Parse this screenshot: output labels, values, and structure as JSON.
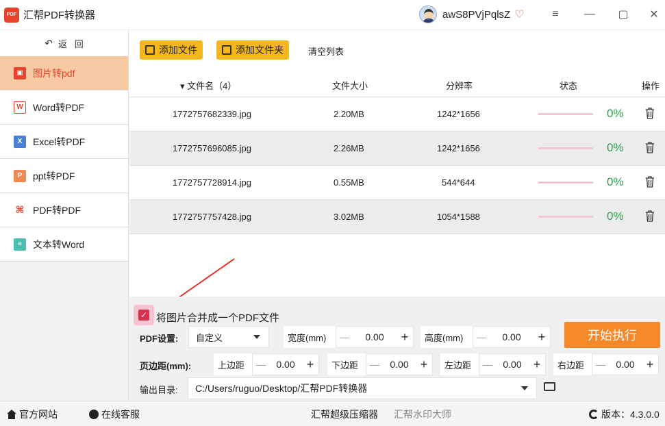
{
  "app": {
    "title": "汇帮PDF转换器",
    "logo_text": "PDF"
  },
  "user": {
    "name": "awS8PVjPqlsZ"
  },
  "window": {
    "menu_icon": "≡",
    "minimize_icon": "—",
    "maximize_icon": "▢",
    "close_icon": "✕"
  },
  "sidebar": {
    "back_label": "返   回",
    "items": [
      {
        "label": "图片转pdf",
        "icon": "image-icon",
        "active": true
      },
      {
        "label": "Word转PDF",
        "icon": "word-icon"
      },
      {
        "label": "Excel转PDF",
        "icon": "excel-icon"
      },
      {
        "label": "ppt转PDF",
        "icon": "ppt-icon"
      },
      {
        "label": "PDF转PDF",
        "icon": "pdf-icon"
      },
      {
        "label": "文本转Word",
        "icon": "text-icon"
      }
    ]
  },
  "toolbar": {
    "add_file": "添加文件",
    "add_folder": "添加文件夹",
    "clear_list": "清空列表"
  },
  "table": {
    "headers": {
      "name": "▾ 文件名（4）",
      "size": "文件大小",
      "resolution": "分辨率",
      "status": "状态",
      "actions": "操作"
    },
    "rows": [
      {
        "name": "1772757682339.jpg",
        "size": "2.20MB",
        "resolution": "1242*1656",
        "progress": "0%"
      },
      {
        "name": "1772757696085.jpg",
        "size": "2.26MB",
        "resolution": "1242*1656",
        "progress": "0%"
      },
      {
        "name": "1772757728914.jpg",
        "size": "0.55MB",
        "resolution": "544*644",
        "progress": "0%"
      },
      {
        "name": "1772757757428.jpg",
        "size": "3.02MB",
        "resolution": "1054*1588",
        "progress": "0%"
      }
    ]
  },
  "settings": {
    "merge_label": "将图片合并成一个PDF文件",
    "merge_checked": true,
    "pdf_settings_label": "PDF设置:",
    "pdf_preset": "自定义",
    "width_label": "宽度(mm)",
    "width_value": "0.00",
    "height_label": "高度(mm)",
    "height_value": "0.00",
    "margin_label": "页边距(mm):",
    "top_label": "上边距",
    "top_value": "0.00",
    "bottom_label": "下边距",
    "bottom_value": "0.00",
    "left_label": "左边距",
    "left_value": "0.00",
    "right_label": "右边距",
    "right_value": "0.00",
    "output_label": "输出目录:",
    "output_path": "C:/Users/ruguo/Desktop/汇帮PDF转换器",
    "start_button": "开始执行"
  },
  "footer": {
    "website": "官方网站",
    "support": "在线客服",
    "compressor": "汇帮超级压缩器",
    "watermark": "汇帮水印大师",
    "version": "版本：4.3.0.0"
  },
  "colors": {
    "accent": "#e8412c",
    "yellow": "#f5b81c",
    "orange": "#f5892a",
    "active_nav": "#f7c9a3",
    "progress_text": "#2aa44c"
  }
}
